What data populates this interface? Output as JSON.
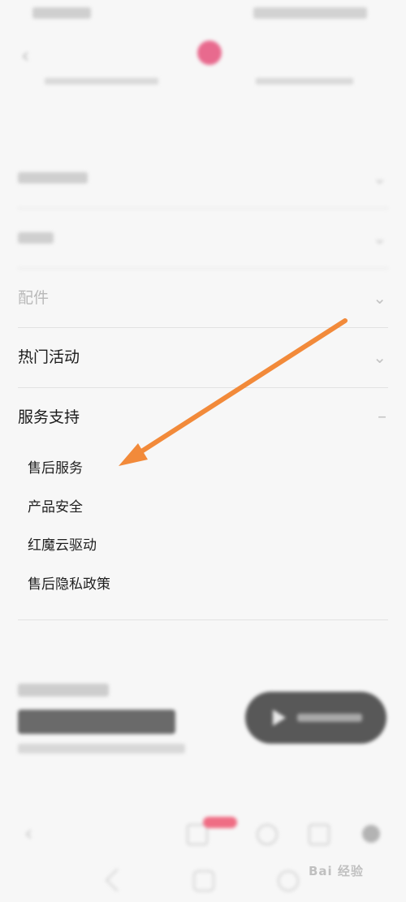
{
  "menu": {
    "items": [
      {
        "label": "",
        "state": "faded"
      },
      {
        "label": "",
        "state": "faded"
      },
      {
        "label": "配件",
        "state": "faded"
      },
      {
        "label": "热门活动",
        "state": "normal"
      },
      {
        "label": "服务支持",
        "state": "expanded"
      }
    ],
    "service_sub": [
      "售后服务",
      "产品安全",
      "红魔云驱动",
      "售后隐私政策"
    ]
  },
  "watermark": "Bai 经验",
  "colors": {
    "arrow": "#f28a3a",
    "accent_pink": "#e86a8e",
    "text": "#1a1a1a"
  }
}
